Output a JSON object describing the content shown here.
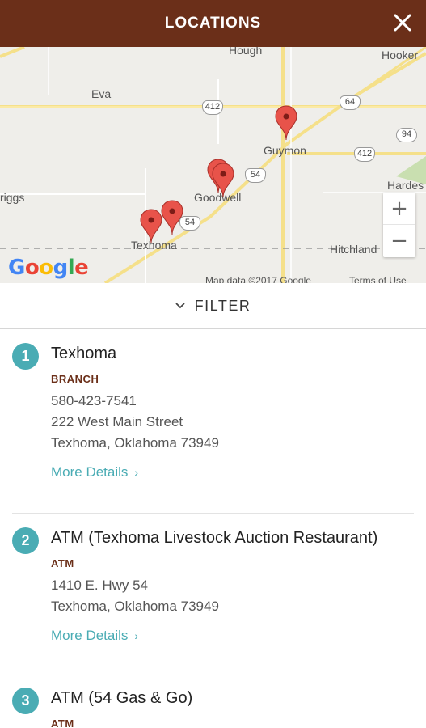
{
  "header": {
    "title": "LOCATIONS"
  },
  "map": {
    "labels": {
      "hough": "Hough",
      "hooker": "Hooker",
      "eva": "Eva",
      "guymon": "Guymon",
      "hardesty": "Hardes",
      "griggs": "riggs",
      "goodwell": "Goodwell",
      "texhoma": "Texhoma",
      "hitchland": "Hitchland"
    },
    "shields": {
      "r412a": "412",
      "r64": "64",
      "r412b": "412",
      "r94": "94",
      "r54a": "54",
      "r54b": "54"
    },
    "google": "Google",
    "attribution": "Map data ©2017 Google",
    "terms": "Terms of Use",
    "zoom_in": "+",
    "zoom_out": "−"
  },
  "filter": {
    "label": "FILTER"
  },
  "locations": [
    {
      "number": "1",
      "name": "Texhoma",
      "type": "BRANCH",
      "phone": "580-423-7541",
      "address1": "222 West Main Street",
      "address2": "Texhoma, Oklahoma 73949",
      "more": "More Details"
    },
    {
      "number": "2",
      "name": "ATM (Texhoma Livestock Auction Restaurant)",
      "type": "ATM",
      "address1": "1410 E. Hwy 54",
      "address2": "Texhoma, Oklahoma 73949",
      "more": "More Details"
    },
    {
      "number": "3",
      "name": "ATM (54 Gas & Go)",
      "type": "ATM"
    }
  ],
  "colors": {
    "header": "#6b2f19",
    "accent": "#4aacb4",
    "pin": "#e8534a"
  }
}
